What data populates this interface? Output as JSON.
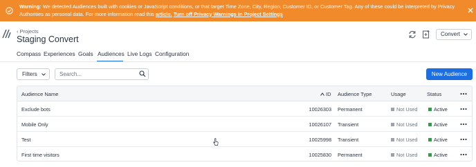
{
  "colors": {
    "banner_bg": "#f08a2b",
    "accent": "#1b6fe0",
    "status_active": "#2ea043",
    "status_unused": "#9aa3ad"
  },
  "banner": {
    "icon": "check-circle-icon",
    "title": "Warning:",
    "message": "We detected Audiences built with cookies or JavaScript conditions, or that target Time Zone, City, Region, Customer ID, or Customer Tag. Any of these could be interpreted by Privacy Authorities as personal data. For more information read this",
    "link_label": "article.",
    "action_label": "Turn off Privacy Warnings in Project Settings",
    "close_icon": "close-icon"
  },
  "header": {
    "breadcrumb": "Projects",
    "title": "Staging Convert",
    "project_menu_label": "Convert"
  },
  "tabs": [
    {
      "label": "Compass"
    },
    {
      "label": "Experiences"
    },
    {
      "label": "Goals"
    },
    {
      "label": "Audiences",
      "active": true
    },
    {
      "label": "Live Logs"
    },
    {
      "label": "Configuration"
    }
  ],
  "toolbar": {
    "filters_label": "Filters",
    "search_placeholder": "Search...",
    "new_button_label": "New Audience"
  },
  "table": {
    "columns": {
      "name": "Audience Name",
      "id": "ID",
      "type": "Audience Type",
      "usage": "Usage",
      "status": "Status"
    },
    "rows": [
      {
        "name": "Exclude bots",
        "id": "10026303",
        "type": "Permanent",
        "usage": "Not Used",
        "status": "Active"
      },
      {
        "name": "Mobile Only",
        "id": "10026107",
        "type": "Transient",
        "usage": "Not Used",
        "status": "Active"
      },
      {
        "name": "Test",
        "id": "10025998",
        "type": "Transient",
        "usage": "Not Used",
        "status": "Active"
      },
      {
        "name": "First time visitors",
        "id": "10025830",
        "type": "Permanent",
        "usage": "Not Used",
        "status": "Active"
      }
    ]
  }
}
